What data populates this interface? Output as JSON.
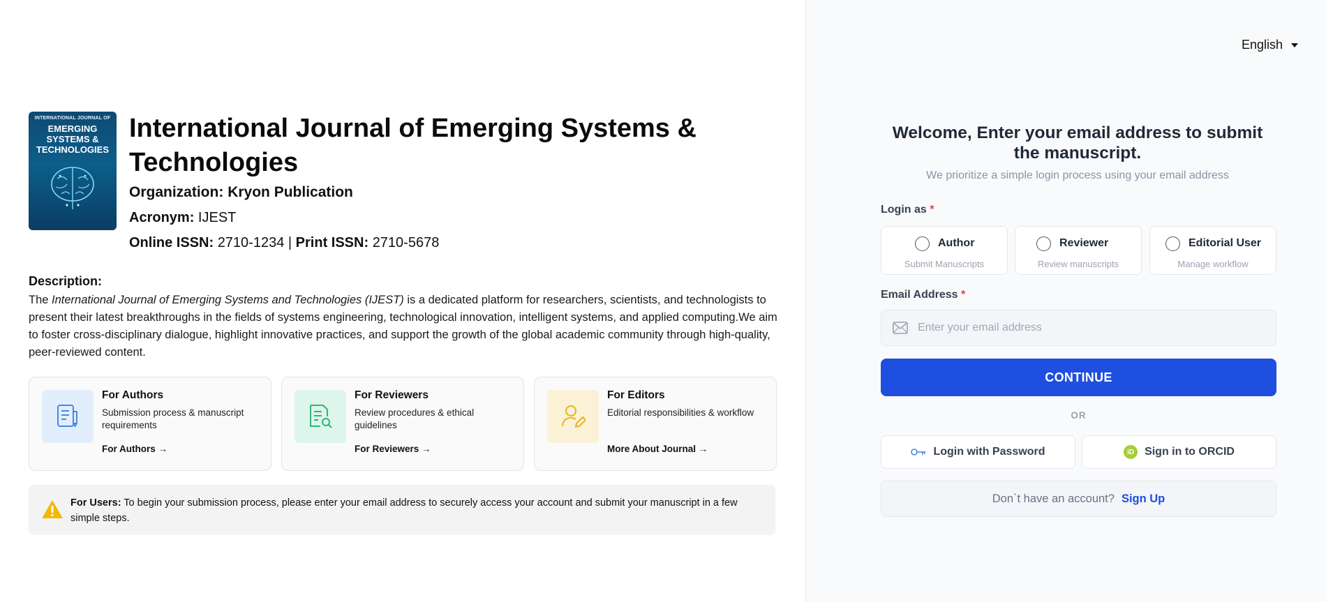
{
  "journal": {
    "cover_small": "INTERNATIONAL JOURNAL OF",
    "cover_big": "EMERGING SYSTEMS & TECHNOLOGIES",
    "title": "International Journal of Emerging Systems & Technologies",
    "organization_label": "Organization:",
    "organization": "Kryon Publication",
    "acronym_label": "Acronym:",
    "acronym": "IJEST",
    "online_issn_label": "Online ISSN:",
    "online_issn": "2710-1234",
    "separator": "|",
    "print_issn_label": "Print ISSN:",
    "print_issn": "2710-5678"
  },
  "description": {
    "label": "Description:",
    "prefix": "The ",
    "italic": "International Journal of Emerging Systems and Technologies (IJEST)",
    "body": " is a dedicated platform for researchers, scientists, and technologists to present their latest breakthroughs in the fields of systems engineering, technological innovation, intelligent systems, and applied computing.We aim to foster cross-disciplinary dialogue, highlight innovative practices, and support the growth of the global academic community through high-quality, peer-reviewed content."
  },
  "cards": [
    {
      "title": "For Authors",
      "desc": "Submission process & manuscript requirements",
      "link": "For Authors →",
      "icon": "document-pen-icon",
      "bg": "#e3eefc",
      "color": "#4a86e8"
    },
    {
      "title": "For Reviewers",
      "desc": "Review procedures & ethical guidelines",
      "link": "For Reviewers →",
      "icon": "document-search-icon",
      "bg": "#ddf5ea",
      "color": "#2fb57d"
    },
    {
      "title": "For Editors",
      "desc": "Editorial responsibilities & workflow",
      "link": "More About Journal →",
      "icon": "user-edit-icon",
      "bg": "#fbf1d6",
      "color": "#e7b320"
    }
  ],
  "notice": {
    "label": "For Users:",
    "text": " To begin your submission process, please enter your email address to securely access your account and submit your manuscript in a few simple steps.",
    "icon": "warning-icon",
    "icon_color": "#f5b800"
  },
  "language": {
    "selected": "English"
  },
  "login": {
    "welcome": "Welcome, Enter your email address to submit the manuscript.",
    "subtitle": "We prioritize a simple login process using your email address",
    "login_as_label": "Login as",
    "required_mark": "*",
    "roles": [
      {
        "label": "Author",
        "sub": "Submit Manuscripts"
      },
      {
        "label": "Reviewer",
        "sub": "Review manuscripts"
      },
      {
        "label": "Editorial User",
        "sub": "Manage workflow"
      }
    ],
    "email_label": "Email Address",
    "email_placeholder": "Enter your email address",
    "continue_label": "CONTINUE",
    "or_label": "OR",
    "password_label": "Login with Password",
    "orcid_label": "Sign in to ORCID",
    "orcid_badge": "iD",
    "signup_question": "Don`t have an account?",
    "signup_link": "Sign Up",
    "accent": "#1e4fde"
  }
}
